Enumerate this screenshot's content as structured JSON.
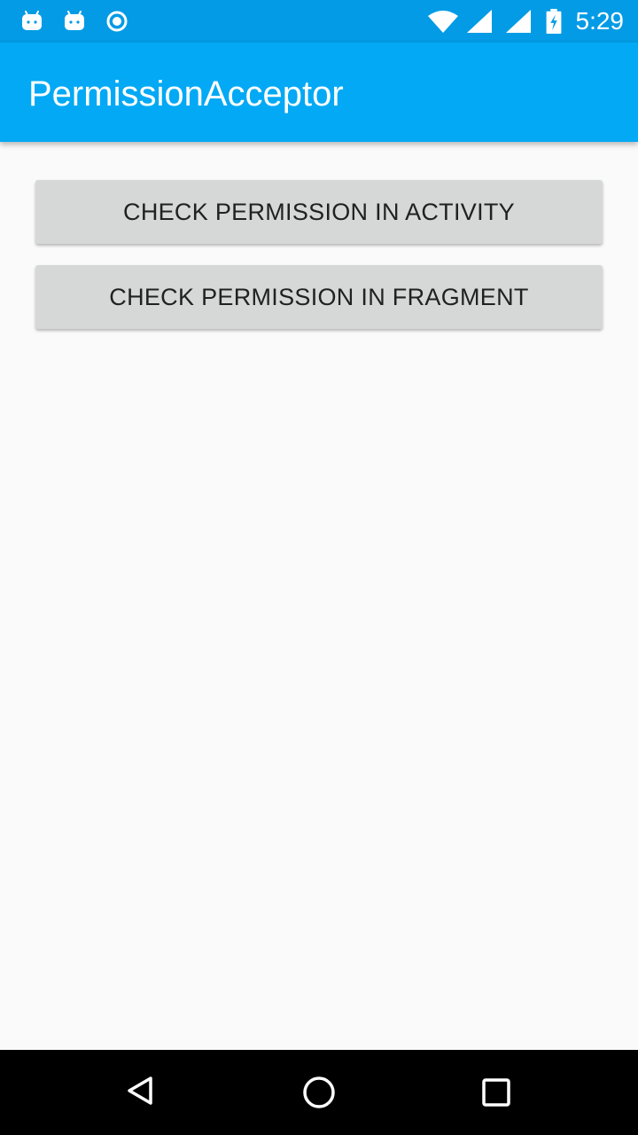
{
  "status_bar": {
    "time": "5:29",
    "left_icons": [
      "android-icon",
      "android-icon",
      "sync-circle-icon"
    ],
    "right_icons": [
      "wifi-icon",
      "signal-icon",
      "signal-icon",
      "battery-charging-icon"
    ]
  },
  "app_bar": {
    "title": "PermissionAcceptor",
    "color": "#03a9f4"
  },
  "main": {
    "buttons": [
      {
        "label": "CHECK PERMISSION IN ACTIVITY"
      },
      {
        "label": "CHECK PERMISSION IN FRAGMENT"
      }
    ]
  },
  "nav_bar": {
    "icons": [
      "back-icon",
      "home-icon",
      "recents-icon"
    ]
  },
  "colors": {
    "status_bar": "#039be5",
    "app_bar": "#03a9f4",
    "background": "#fafafa",
    "button": "#d6d7d7",
    "button_text": "#212121"
  }
}
